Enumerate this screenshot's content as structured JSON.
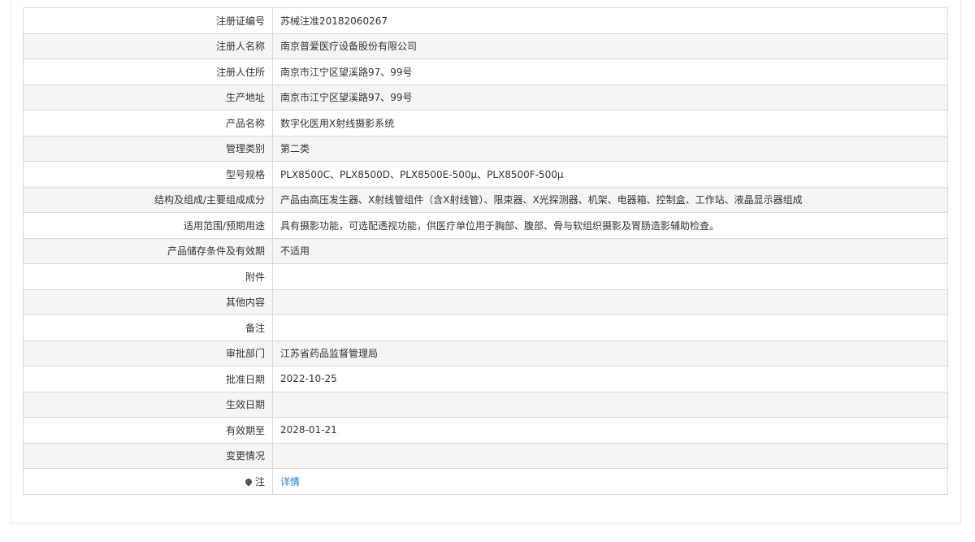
{
  "rows": [
    {
      "label": "注册证编号",
      "value": "苏械注准20182060267"
    },
    {
      "label": "注册人名称",
      "value": "南京普爱医疗设备股份有限公司"
    },
    {
      "label": "注册人住所",
      "value": "南京市江宁区望溪路97、99号"
    },
    {
      "label": "生产地址",
      "value": "南京市江宁区望溪路97、99号"
    },
    {
      "label": "产品名称",
      "value": "数字化医用X射线摄影系统"
    },
    {
      "label": "管理类别",
      "value": "第二类"
    },
    {
      "label": "型号规格",
      "value": "PLX8500C、PLX8500D、PLX8500E-500μ、PLX8500F-500μ"
    },
    {
      "label": "结构及组成/主要组成成分",
      "value": "产品由高压发生器、X射线管组件（含X射线管）、限束器、X光探测器、机架、电器箱、控制盒、工作站、液晶显示器组成"
    },
    {
      "label": "适用范围/预期用途",
      "value": "具有摄影功能，可选配透视功能，供医疗单位用于胸部、腹部、骨与软组织摄影及胃肠造影辅助检查。"
    },
    {
      "label": "产品储存条件及有效期",
      "value": "不适用"
    },
    {
      "label": "附件",
      "value": ""
    },
    {
      "label": "其他内容",
      "value": ""
    },
    {
      "label": "备注",
      "value": ""
    },
    {
      "label": "审批部门",
      "value": "江苏省药品监督管理局"
    },
    {
      "label": "批准日期",
      "value": "2022-10-25"
    },
    {
      "label": "生效日期",
      "value": ""
    },
    {
      "label": "有效期至",
      "value": "2028-01-21"
    },
    {
      "label": "变更情况",
      "value": ""
    }
  ],
  "note_row": {
    "icon": "pin-icon",
    "label": "注",
    "link_text": "详情"
  },
  "colors": {
    "link": "#2a7fc1",
    "stripe": "#f5f5f5",
    "border": "#d9d9d9"
  }
}
